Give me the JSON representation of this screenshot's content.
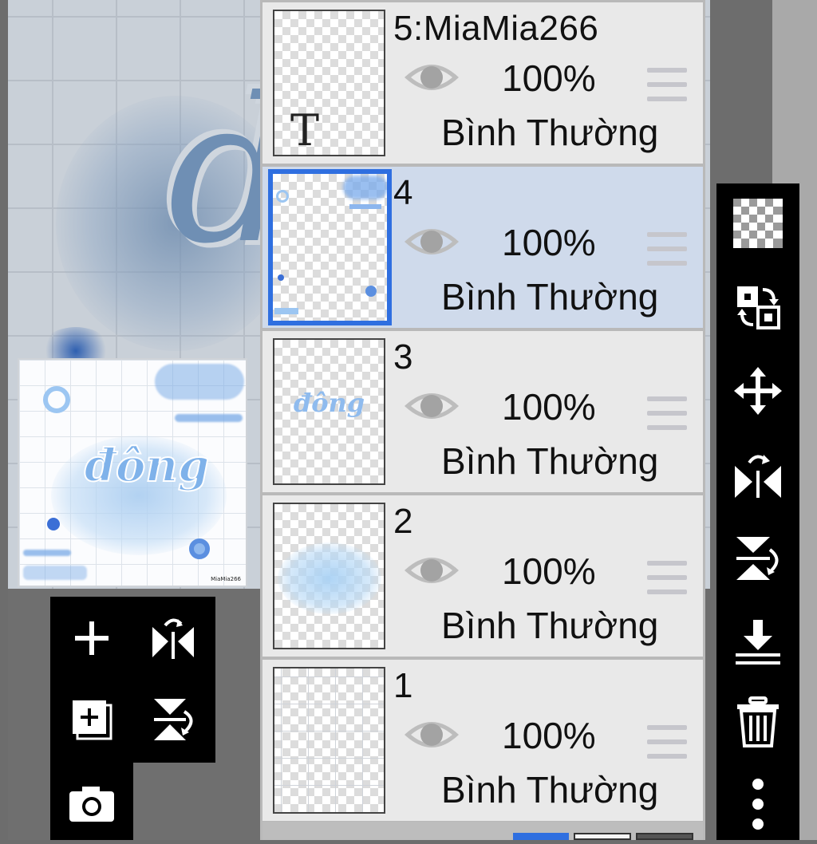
{
  "layers": [
    {
      "name": "5:MiaMia266",
      "opacity": "100%",
      "blend_mode": "Bình Thường",
      "selected": false,
      "thumb_glyph": "T"
    },
    {
      "name": "4",
      "opacity": "100%",
      "blend_mode": "Bình Thường",
      "selected": true
    },
    {
      "name": "3",
      "opacity": "100%",
      "blend_mode": "Bình Thường",
      "selected": false,
      "thumb_text": "đông"
    },
    {
      "name": "2",
      "opacity": "100%",
      "blend_mode": "Bình Thường",
      "selected": false
    },
    {
      "name": "1",
      "opacity": "100%",
      "blend_mode": "Bình Thường",
      "selected": false
    }
  ],
  "preview": {
    "artwork_text": "đông",
    "signature": "MiaMia266"
  },
  "left_toolbar": [
    "add-layer-icon",
    "flip-horizontal-icon",
    "add-copy-layer-icon",
    "flip-vertical-icon",
    "camera-icon"
  ],
  "right_toolbar": [
    "transparency-checker-icon",
    "swap-layers-icon",
    "move-icon",
    "flip-horizontal-icon",
    "flip-vertical-icon",
    "merge-down-icon",
    "trash-icon",
    "more-icon"
  ],
  "colors": {
    "selected_layer_bg": "#cfdaeb",
    "selected_border": "#2f6fe0",
    "layer_bg": "#e9e9e9",
    "toolbar_bg": "#000000"
  }
}
